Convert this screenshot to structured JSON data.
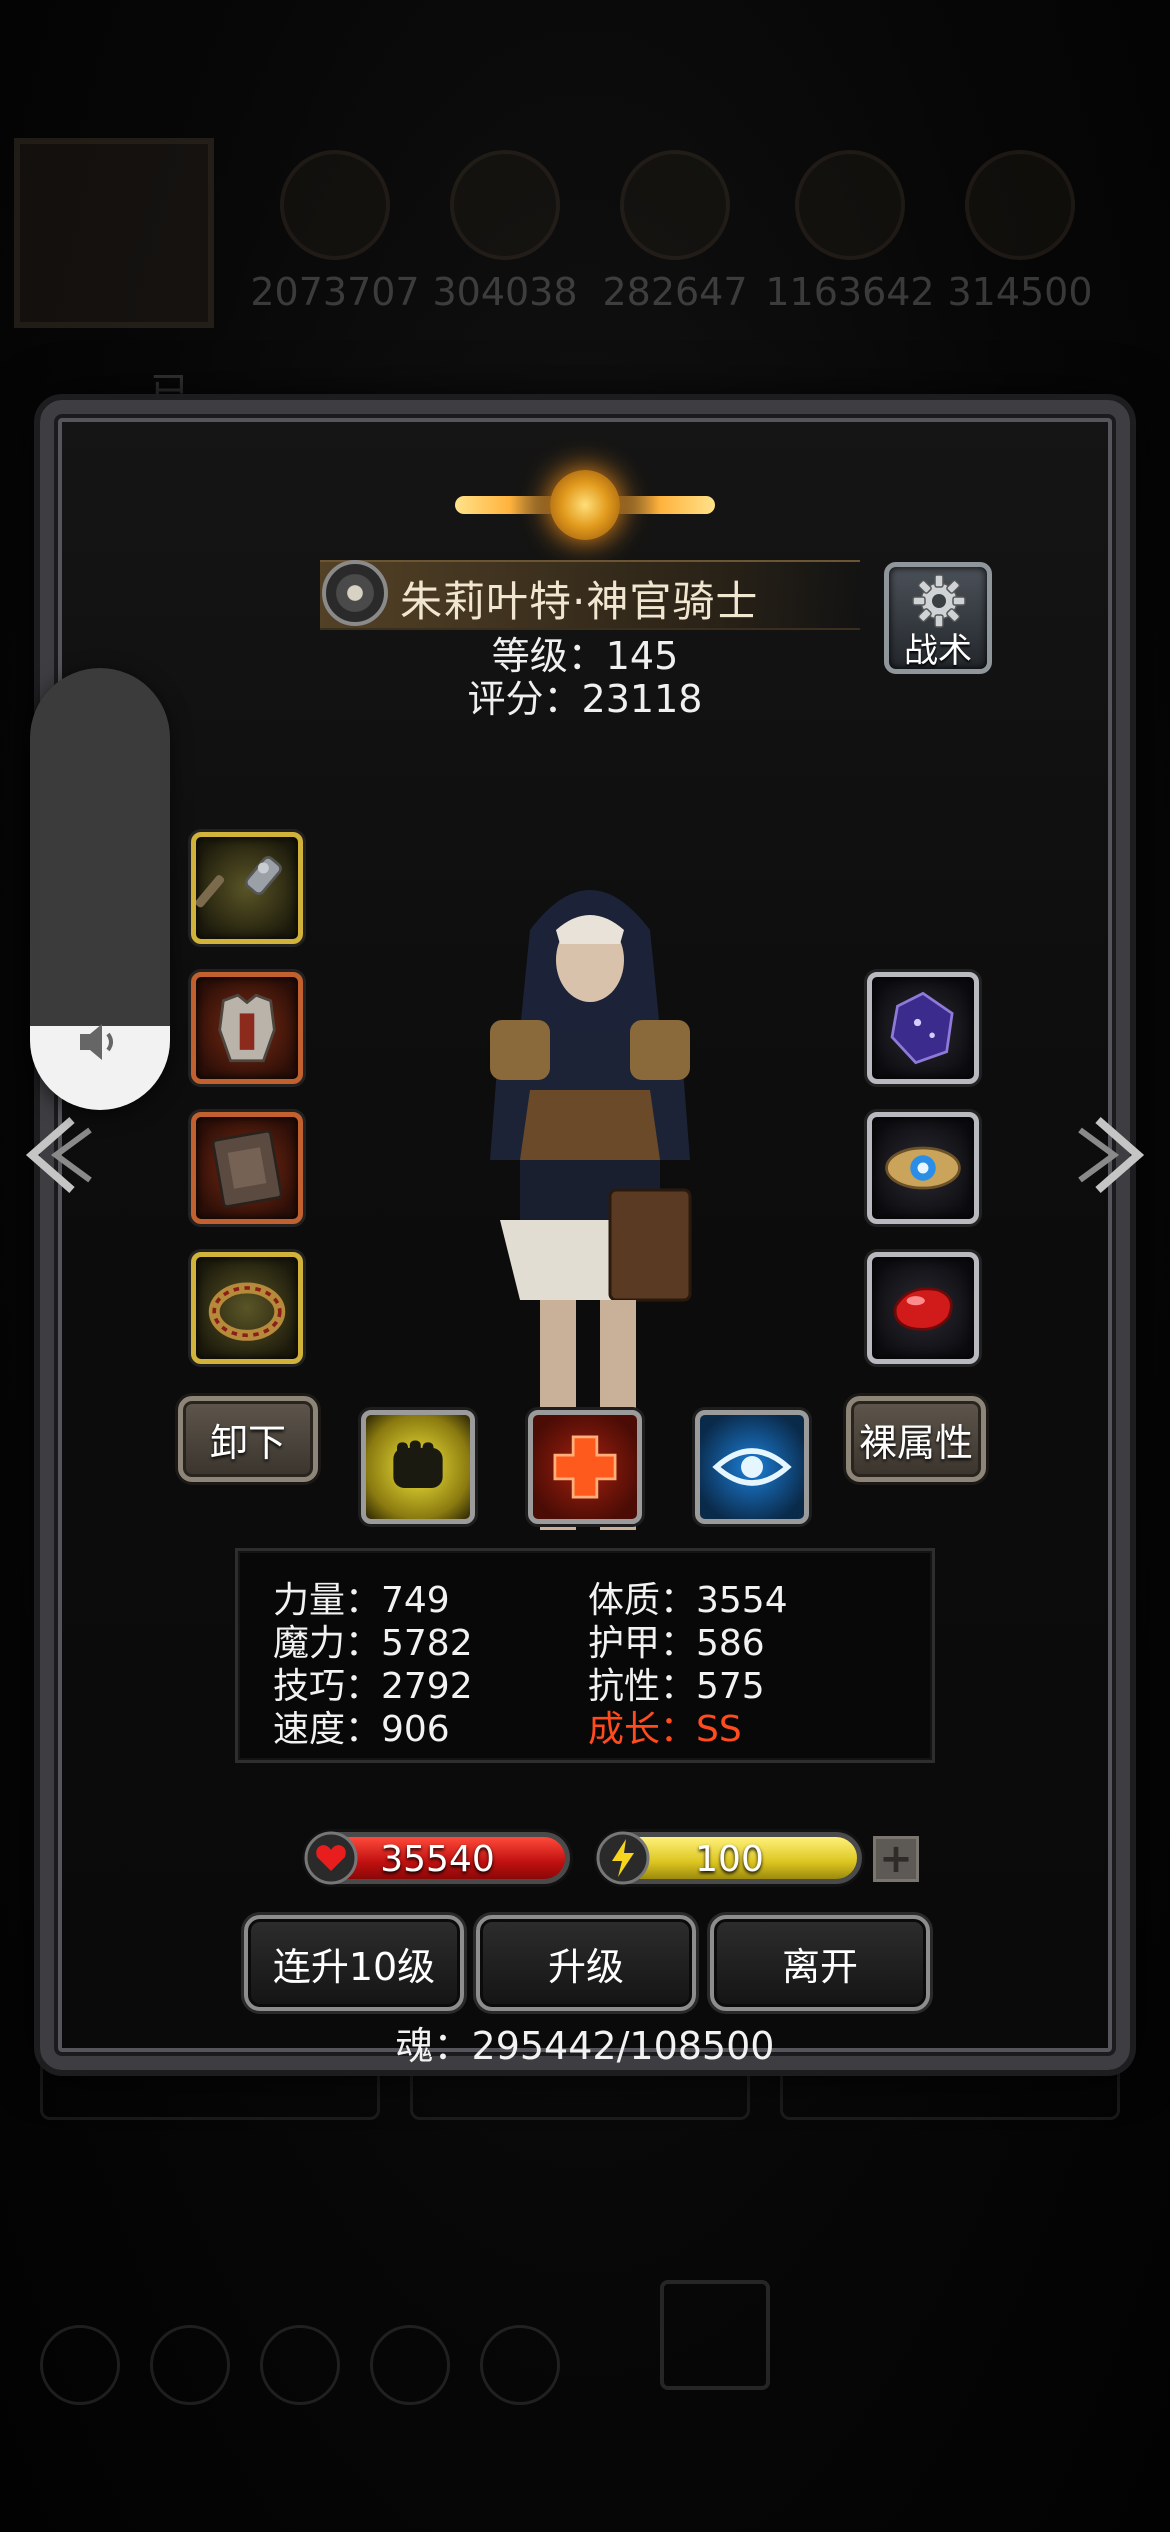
{
  "background": {
    "resources": [
      "2073707",
      "304038",
      "282647",
      "1163642",
      "314500"
    ],
    "status_line": "已..."
  },
  "hero": {
    "name": "朱莉叶特·神官骑士",
    "level": "等级：145",
    "score": "评分：23118"
  },
  "tactics": {
    "label": "战术"
  },
  "buttons": {
    "unequip": "卸下",
    "naked_attr": "裸属性",
    "level_up_10": "连升10级",
    "level_up": "升级",
    "leave": "离开"
  },
  "stats": {
    "strength": "力量：749",
    "magic": "魔力：5782",
    "skill": "技巧：2792",
    "speed": "速度：906",
    "constitution": "体质：3554",
    "armor": "护甲：586",
    "resistance": "抗性：575",
    "growth": "成长：SS"
  },
  "bars": {
    "hp": "35540",
    "energy": "100",
    "plus": "+"
  },
  "soul": "魂：295442/108500",
  "volume": {
    "level": 0.19
  },
  "colors": {
    "growth": "#ff4b1e",
    "hp": "#c01010",
    "energy": "#dcc521",
    "gold_slot": "#d1b23a",
    "red_slot": "#c0612f"
  },
  "icons": {
    "left_slots": [
      "mace-icon",
      "chest-armor-icon",
      "tome-icon",
      "ring-icon"
    ],
    "right_slots": [
      "purple-gem-icon",
      "blue-eye-amulet-icon",
      "red-stone-icon"
    ],
    "runes": [
      "fist-icon",
      "heal-cross-icon",
      "eye-icon"
    ]
  }
}
